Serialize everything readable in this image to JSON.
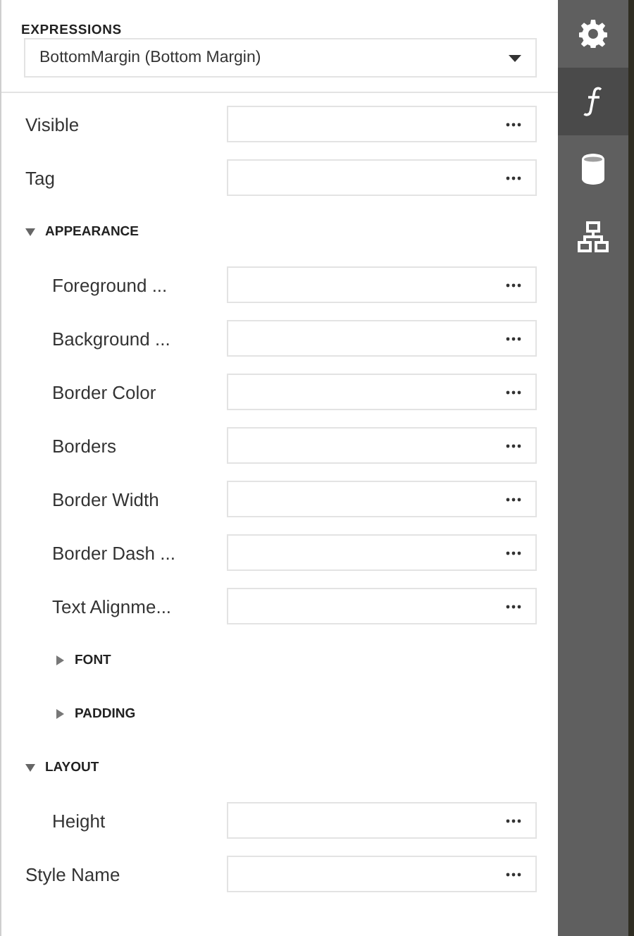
{
  "panel": {
    "title": "EXPRESSIONS",
    "dropdown": {
      "value": "BottomMargin (Bottom Margin)"
    }
  },
  "properties": [
    {
      "kind": "property",
      "label": "Visible"
    },
    {
      "kind": "property",
      "label": "Tag"
    },
    {
      "kind": "group",
      "label": "APPEARANCE",
      "expanded": true,
      "children": [
        {
          "kind": "property",
          "label": "Foreground ..."
        },
        {
          "kind": "property",
          "label": "Background ..."
        },
        {
          "kind": "property",
          "label": "Border Color"
        },
        {
          "kind": "property",
          "label": "Borders"
        },
        {
          "kind": "property",
          "label": "Border Width"
        },
        {
          "kind": "property",
          "label": "Border Dash ..."
        },
        {
          "kind": "property",
          "label": "Text Alignme..."
        },
        {
          "kind": "group",
          "label": "FONT",
          "expanded": false
        },
        {
          "kind": "group",
          "label": "PADDING",
          "expanded": false
        }
      ]
    },
    {
      "kind": "group",
      "label": "LAYOUT",
      "expanded": true,
      "children": [
        {
          "kind": "property",
          "label": "Height"
        }
      ]
    },
    {
      "kind": "property",
      "label": "Style Name"
    }
  ],
  "sidebar": {
    "tabs": [
      {
        "kind": "settings",
        "selected": false
      },
      {
        "kind": "function",
        "selected": true
      },
      {
        "kind": "database",
        "selected": false
      },
      {
        "kind": "hierarchy",
        "selected": false
      }
    ]
  }
}
